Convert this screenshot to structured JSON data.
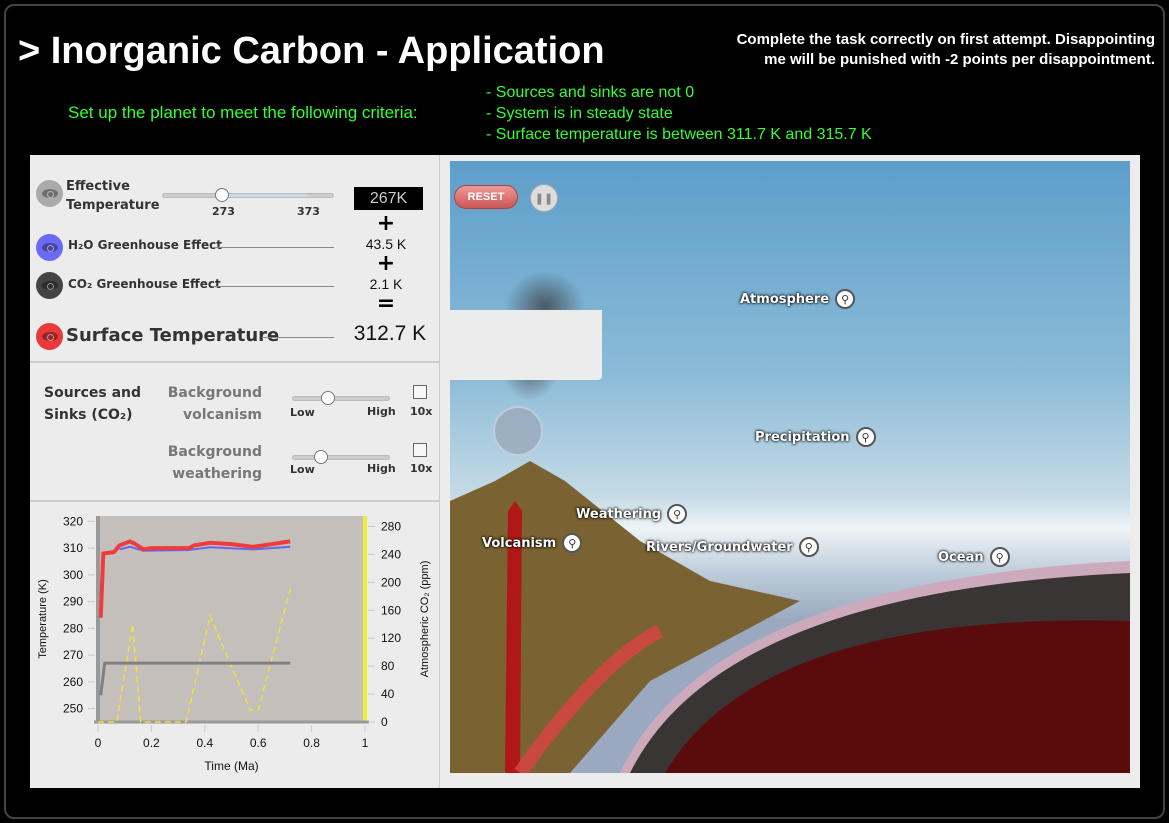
{
  "header": {
    "title": "> Inorganic Carbon - Application",
    "warning_line1": "Complete the task correctly on first attempt.  Disappointing",
    "warning_line2": "me will be punished with -2 points per disappointment.",
    "prompt": "Set up the planet to meet the following criteria:",
    "criteria": [
      "- Sources and sinks are not 0",
      "- System is in steady state",
      "- Surface temperature is between 311.7 K and 315.7 K"
    ]
  },
  "temperature": {
    "effective_label_1": "Effective",
    "effective_label_2": "Temperature",
    "slider_min": "273",
    "slider_max": "373",
    "slider_value": "267K",
    "h2o_label": "H₂O Greenhouse Effect",
    "h2o_value": "43.5 K",
    "co2_label": "CO₂ Greenhouse Effect",
    "co2_value": "2.1 K",
    "plus": "+",
    "equals": "=",
    "surface_label": "Surface Temperature",
    "surface_value": "312.7 K",
    "colors": {
      "effective": "#aaaaaa",
      "h2o": "#6a6af5",
      "co2": "#444444",
      "surface": "#e83a3a"
    }
  },
  "sources": {
    "title_1": "Sources and",
    "title_2": "Sinks (CO₂)",
    "volcanism_1": "Background",
    "volcanism_2": "volcanism",
    "weathering_1": "Background",
    "weathering_2": "weathering",
    "low": "Low",
    "high": "High",
    "x10": "10x",
    "volcanism_level": 0.4,
    "weathering_level": 0.3,
    "volcanism_10x": false,
    "weathering_10x": false
  },
  "chart_data": {
    "type": "line",
    "xlabel": "Time (Ma)",
    "ylabel": "Temperature (K)",
    "y2label": "Atmospheric CO₂ (ppm)",
    "xlim": [
      0,
      1
    ],
    "ylim": [
      245,
      322
    ],
    "y2lim": [
      0,
      295
    ],
    "xticks": [
      "0",
      "0.2",
      "0.4",
      "0.6",
      "0.8",
      "1"
    ],
    "yticks": [
      "320",
      "310",
      "300",
      "290",
      "280",
      "270",
      "260",
      "250"
    ],
    "y2ticks": [
      "280",
      "240",
      "200",
      "160",
      "120",
      "80",
      "40",
      "0"
    ],
    "series": [
      {
        "axis": "left",
        "color": "#ee3b3b",
        "points": [
          [
            0.01,
            284
          ],
          [
            0.02,
            308
          ],
          [
            0.06,
            308.5
          ],
          [
            0.08,
            311
          ],
          [
            0.12,
            312.5
          ],
          [
            0.14,
            311.5
          ],
          [
            0.17,
            309.5
          ],
          [
            0.2,
            310
          ],
          [
            0.34,
            310
          ],
          [
            0.36,
            311
          ],
          [
            0.42,
            312
          ],
          [
            0.5,
            311.5
          ],
          [
            0.58,
            310.5
          ],
          [
            0.62,
            311
          ],
          [
            0.72,
            312.5
          ]
        ]
      },
      {
        "axis": "left",
        "color": "#6666ee",
        "points": [
          [
            0.08,
            309.5
          ],
          [
            0.12,
            310.5
          ],
          [
            0.17,
            309
          ],
          [
            0.34,
            309.3
          ],
          [
            0.42,
            310.3
          ],
          [
            0.58,
            309.5
          ],
          [
            0.72,
            310.5
          ]
        ]
      },
      {
        "axis": "left",
        "color": "#808080",
        "points": [
          [
            0.01,
            255
          ],
          [
            0.025,
            267
          ],
          [
            0.72,
            267
          ]
        ]
      },
      {
        "axis": "right",
        "color": "#f0e040",
        "dashed": true,
        "points": [
          [
            0,
            0
          ],
          [
            0.07,
            0
          ],
          [
            0.13,
            140
          ],
          [
            0.16,
            0
          ],
          [
            0.33,
            0
          ],
          [
            0.42,
            152
          ],
          [
            0.57,
            17
          ],
          [
            0.6,
            17
          ],
          [
            0.72,
            190
          ]
        ]
      }
    ]
  },
  "scene": {
    "reset": "RESET",
    "labels": [
      "Atmosphere",
      "Precipitation",
      "Weathering",
      "Volcanism",
      "Rivers/Groundwater",
      "Ocean"
    ]
  }
}
